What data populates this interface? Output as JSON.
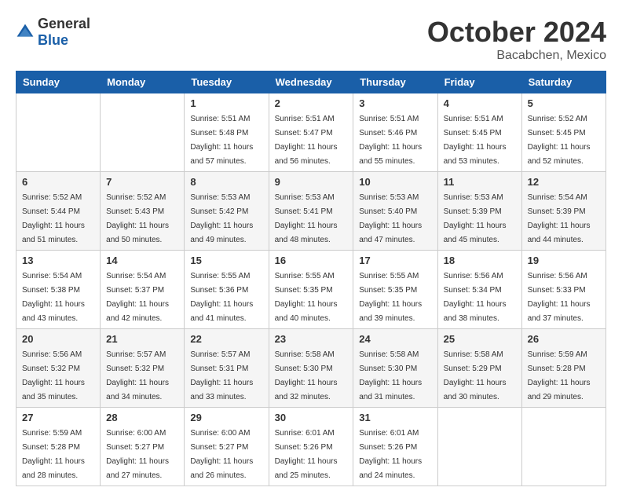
{
  "logo": {
    "text_general": "General",
    "text_blue": "Blue"
  },
  "title": {
    "month": "October 2024",
    "location": "Bacabchen, Mexico"
  },
  "weekdays": [
    "Sunday",
    "Monday",
    "Tuesday",
    "Wednesday",
    "Thursday",
    "Friday",
    "Saturday"
  ],
  "weeks": [
    [
      {
        "day": "",
        "sunrise": "",
        "sunset": "",
        "daylight": ""
      },
      {
        "day": "",
        "sunrise": "",
        "sunset": "",
        "daylight": ""
      },
      {
        "day": "1",
        "sunrise": "Sunrise: 5:51 AM",
        "sunset": "Sunset: 5:48 PM",
        "daylight": "Daylight: 11 hours and 57 minutes."
      },
      {
        "day": "2",
        "sunrise": "Sunrise: 5:51 AM",
        "sunset": "Sunset: 5:47 PM",
        "daylight": "Daylight: 11 hours and 56 minutes."
      },
      {
        "day": "3",
        "sunrise": "Sunrise: 5:51 AM",
        "sunset": "Sunset: 5:46 PM",
        "daylight": "Daylight: 11 hours and 55 minutes."
      },
      {
        "day": "4",
        "sunrise": "Sunrise: 5:51 AM",
        "sunset": "Sunset: 5:45 PM",
        "daylight": "Daylight: 11 hours and 53 minutes."
      },
      {
        "day": "5",
        "sunrise": "Sunrise: 5:52 AM",
        "sunset": "Sunset: 5:45 PM",
        "daylight": "Daylight: 11 hours and 52 minutes."
      }
    ],
    [
      {
        "day": "6",
        "sunrise": "Sunrise: 5:52 AM",
        "sunset": "Sunset: 5:44 PM",
        "daylight": "Daylight: 11 hours and 51 minutes."
      },
      {
        "day": "7",
        "sunrise": "Sunrise: 5:52 AM",
        "sunset": "Sunset: 5:43 PM",
        "daylight": "Daylight: 11 hours and 50 minutes."
      },
      {
        "day": "8",
        "sunrise": "Sunrise: 5:53 AM",
        "sunset": "Sunset: 5:42 PM",
        "daylight": "Daylight: 11 hours and 49 minutes."
      },
      {
        "day": "9",
        "sunrise": "Sunrise: 5:53 AM",
        "sunset": "Sunset: 5:41 PM",
        "daylight": "Daylight: 11 hours and 48 minutes."
      },
      {
        "day": "10",
        "sunrise": "Sunrise: 5:53 AM",
        "sunset": "Sunset: 5:40 PM",
        "daylight": "Daylight: 11 hours and 47 minutes."
      },
      {
        "day": "11",
        "sunrise": "Sunrise: 5:53 AM",
        "sunset": "Sunset: 5:39 PM",
        "daylight": "Daylight: 11 hours and 45 minutes."
      },
      {
        "day": "12",
        "sunrise": "Sunrise: 5:54 AM",
        "sunset": "Sunset: 5:39 PM",
        "daylight": "Daylight: 11 hours and 44 minutes."
      }
    ],
    [
      {
        "day": "13",
        "sunrise": "Sunrise: 5:54 AM",
        "sunset": "Sunset: 5:38 PM",
        "daylight": "Daylight: 11 hours and 43 minutes."
      },
      {
        "day": "14",
        "sunrise": "Sunrise: 5:54 AM",
        "sunset": "Sunset: 5:37 PM",
        "daylight": "Daylight: 11 hours and 42 minutes."
      },
      {
        "day": "15",
        "sunrise": "Sunrise: 5:55 AM",
        "sunset": "Sunset: 5:36 PM",
        "daylight": "Daylight: 11 hours and 41 minutes."
      },
      {
        "day": "16",
        "sunrise": "Sunrise: 5:55 AM",
        "sunset": "Sunset: 5:35 PM",
        "daylight": "Daylight: 11 hours and 40 minutes."
      },
      {
        "day": "17",
        "sunrise": "Sunrise: 5:55 AM",
        "sunset": "Sunset: 5:35 PM",
        "daylight": "Daylight: 11 hours and 39 minutes."
      },
      {
        "day": "18",
        "sunrise": "Sunrise: 5:56 AM",
        "sunset": "Sunset: 5:34 PM",
        "daylight": "Daylight: 11 hours and 38 minutes."
      },
      {
        "day": "19",
        "sunrise": "Sunrise: 5:56 AM",
        "sunset": "Sunset: 5:33 PM",
        "daylight": "Daylight: 11 hours and 37 minutes."
      }
    ],
    [
      {
        "day": "20",
        "sunrise": "Sunrise: 5:56 AM",
        "sunset": "Sunset: 5:32 PM",
        "daylight": "Daylight: 11 hours and 35 minutes."
      },
      {
        "day": "21",
        "sunrise": "Sunrise: 5:57 AM",
        "sunset": "Sunset: 5:32 PM",
        "daylight": "Daylight: 11 hours and 34 minutes."
      },
      {
        "day": "22",
        "sunrise": "Sunrise: 5:57 AM",
        "sunset": "Sunset: 5:31 PM",
        "daylight": "Daylight: 11 hours and 33 minutes."
      },
      {
        "day": "23",
        "sunrise": "Sunrise: 5:58 AM",
        "sunset": "Sunset: 5:30 PM",
        "daylight": "Daylight: 11 hours and 32 minutes."
      },
      {
        "day": "24",
        "sunrise": "Sunrise: 5:58 AM",
        "sunset": "Sunset: 5:30 PM",
        "daylight": "Daylight: 11 hours and 31 minutes."
      },
      {
        "day": "25",
        "sunrise": "Sunrise: 5:58 AM",
        "sunset": "Sunset: 5:29 PM",
        "daylight": "Daylight: 11 hours and 30 minutes."
      },
      {
        "day": "26",
        "sunrise": "Sunrise: 5:59 AM",
        "sunset": "Sunset: 5:28 PM",
        "daylight": "Daylight: 11 hours and 29 minutes."
      }
    ],
    [
      {
        "day": "27",
        "sunrise": "Sunrise: 5:59 AM",
        "sunset": "Sunset: 5:28 PM",
        "daylight": "Daylight: 11 hours and 28 minutes."
      },
      {
        "day": "28",
        "sunrise": "Sunrise: 6:00 AM",
        "sunset": "Sunset: 5:27 PM",
        "daylight": "Daylight: 11 hours and 27 minutes."
      },
      {
        "day": "29",
        "sunrise": "Sunrise: 6:00 AM",
        "sunset": "Sunset: 5:27 PM",
        "daylight": "Daylight: 11 hours and 26 minutes."
      },
      {
        "day": "30",
        "sunrise": "Sunrise: 6:01 AM",
        "sunset": "Sunset: 5:26 PM",
        "daylight": "Daylight: 11 hours and 25 minutes."
      },
      {
        "day": "31",
        "sunrise": "Sunrise: 6:01 AM",
        "sunset": "Sunset: 5:26 PM",
        "daylight": "Daylight: 11 hours and 24 minutes."
      },
      {
        "day": "",
        "sunrise": "",
        "sunset": "",
        "daylight": ""
      },
      {
        "day": "",
        "sunrise": "",
        "sunset": "",
        "daylight": ""
      }
    ]
  ]
}
